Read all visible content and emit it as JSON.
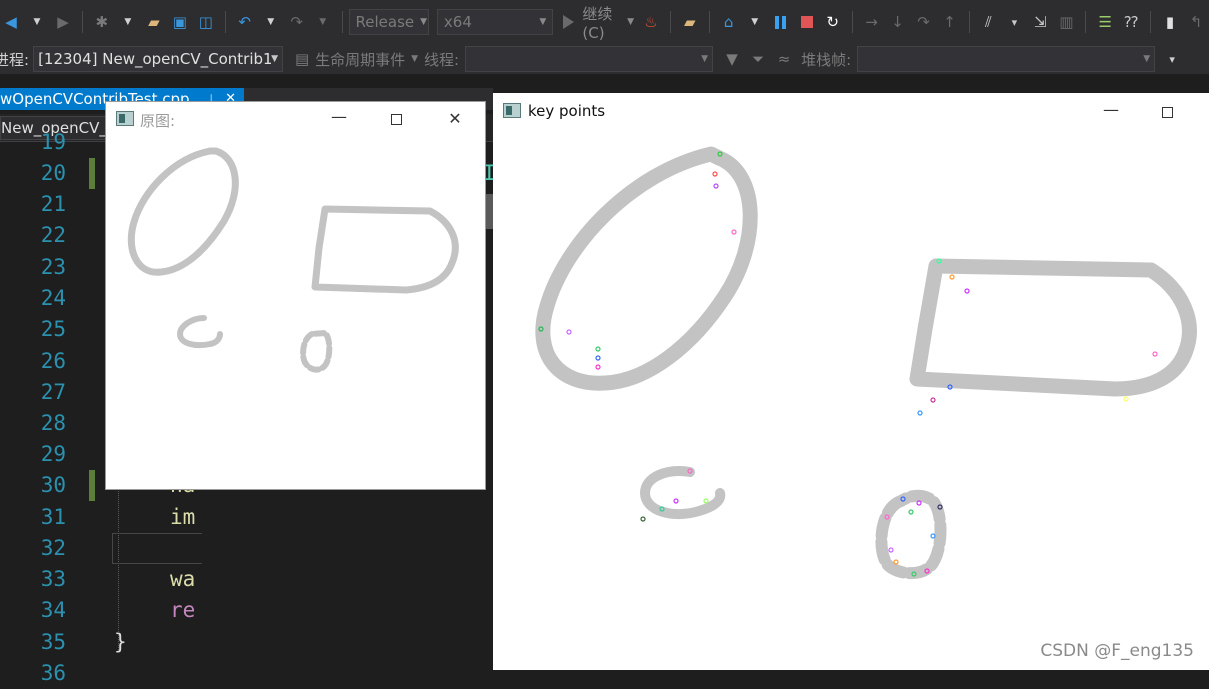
{
  "toolbar": {
    "config_value": "Release",
    "platform_value": "x64",
    "continue_label": "继续(C)",
    "icons": [
      "back-icon",
      "forward-icon",
      "new-project-icon",
      "open-file-icon",
      "save-icon",
      "save-all-icon",
      "undo-icon",
      "redo-icon",
      "start-icon",
      "hot-reload-icon",
      "open-folder-icon",
      "diagnostics-icon",
      "pause-icon",
      "stop-icon",
      "restart-icon",
      "step-over-icon",
      "step-into-icon",
      "step-out-icon",
      "show-next-statement-icon"
    ]
  },
  "debug_bar": {
    "process_label": "进程:",
    "process_value": "[12304] New_openCV_Contrib1",
    "lifecycle_label": "生命周期事件",
    "thread_label": "线程:",
    "thread_value": "",
    "stackframe_label": "堆栈帧:",
    "stackframe_value": ""
  },
  "editor": {
    "tab_title": "wOpenCVContribTest.cpp",
    "nav_value": "New_openCV_",
    "line_numbers": [
      "19",
      "20",
      "21",
      "22",
      "23",
      "24",
      "25",
      "26",
      "27",
      "28",
      "29",
      "30",
      "31",
      "32",
      "33",
      "34",
      "35",
      "36"
    ],
    "code_fragments": {
      "l20": "I",
      "l30": "na",
      "l31": "im",
      "l33": "wa",
      "l34": "re",
      "l35": "}"
    }
  },
  "window_original": {
    "title": "原图:",
    "min_glyph": "—",
    "close_glyph": "✕"
  },
  "window_keypoints": {
    "title": "key points",
    "min_glyph": "—"
  },
  "watermark": "CSDN @F_eng135"
}
